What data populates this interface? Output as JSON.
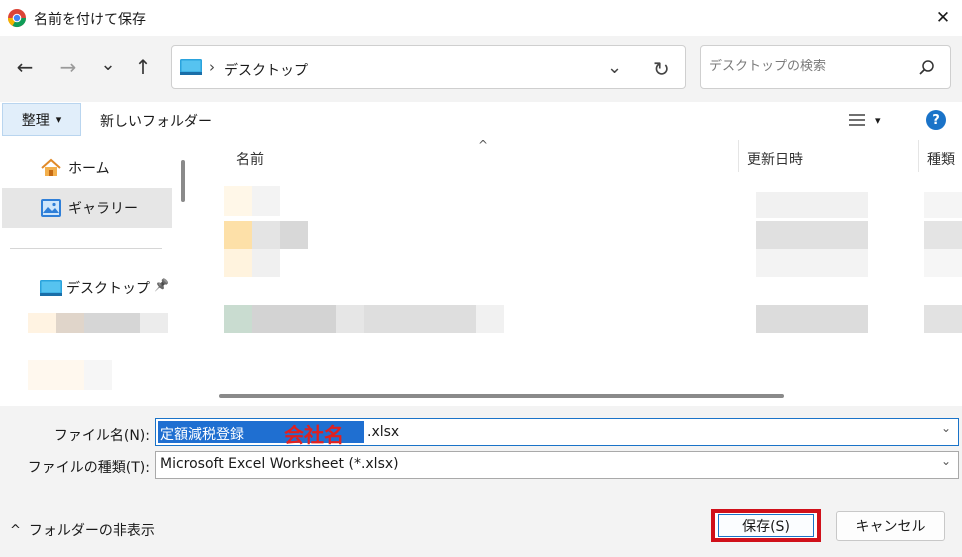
{
  "window": {
    "title": "名前を付けて保存",
    "close_glyph": "✕"
  },
  "nav": {
    "back_glyph": "←",
    "forward_glyph": "→",
    "recent_glyph": "⌄",
    "up_glyph": "↑",
    "separator_glyph": "›",
    "location": "デスクトップ",
    "refresh_glyph": "↻",
    "search_placeholder": "デスクトップの検索"
  },
  "toolbar": {
    "organize_label": "整理",
    "organize_chevron": "▾",
    "new_folder_label": "新しいフォルダー",
    "view_chevron": "▾",
    "help_glyph": "?"
  },
  "sidebar": {
    "items": [
      {
        "label": "ホーム",
        "icon": "home-icon"
      },
      {
        "label": "ギャラリー",
        "icon": "gallery-icon"
      },
      {
        "label": "デスクトップ",
        "icon": "desktop-icon"
      }
    ],
    "pin_glyph": "📌"
  },
  "file_list": {
    "sort_glyph": "^",
    "columns": [
      "名前",
      "更新日時",
      "種類"
    ]
  },
  "form": {
    "filename_label": "ファイル名(N):",
    "filename_value": "定額減税登録",
    "filename_extension": ".xlsx",
    "company_annotation": "会社名",
    "filetype_label": "ファイルの種類(T):",
    "filetype_value": "Microsoft Excel Worksheet (*.xlsx)",
    "combo_chevron": "⌄"
  },
  "footer": {
    "hide_folders_chevron": "^",
    "hide_folders_label": "フォルダーの非表示",
    "save_label": "保存(S)",
    "cancel_label": "キャンセル"
  },
  "colors": {
    "accent": "#1a73c8",
    "selection": "#1f6fd1",
    "highlight_border": "#d0101a",
    "annotation_text": "#e02020",
    "panel_bg": "#f3f3f3"
  }
}
